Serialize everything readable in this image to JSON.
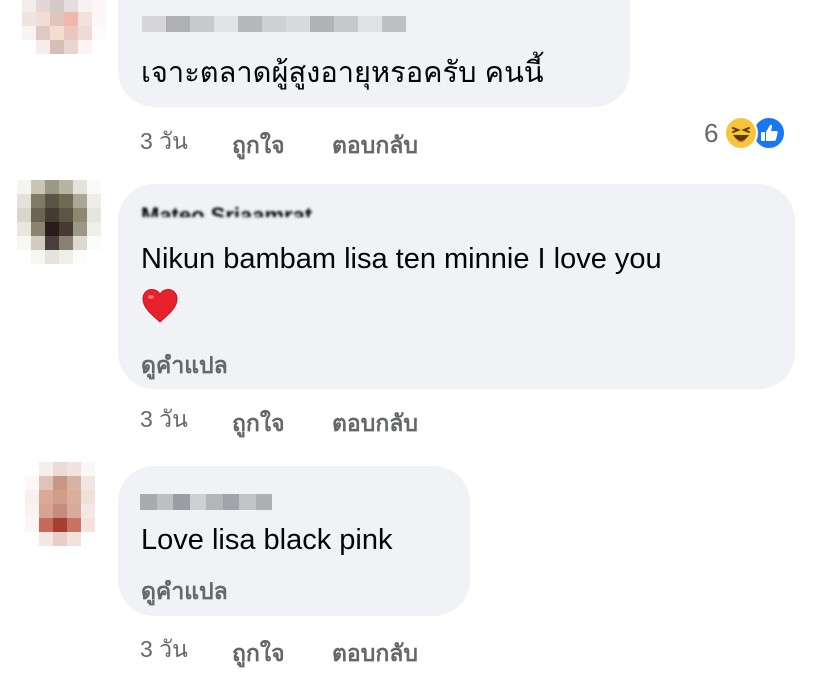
{
  "comments": [
    {
      "text": "เจาะตลาดผู้สูงอายุหรอครับ คนนี้",
      "time": "3 วัน",
      "like_label": "ถูกใจ",
      "reply_label": "ตอบกลับ",
      "reaction_count": "6",
      "reaction_icons": [
        "laughing-emoji-icon",
        "thumbs-up-icon"
      ]
    },
    {
      "author": "Mateo Sriaamrat",
      "text": "Nikun bambam lisa ten minnie I love you",
      "emoji": "❤️",
      "translate_label": "ดูคำแปล",
      "time": "3 วัน",
      "like_label": "ถูกใจ",
      "reply_label": "ตอบกลับ"
    },
    {
      "text": "Love lisa black pink",
      "translate_label": "ดูคำแปล",
      "time": "3 วัน",
      "like_label": "ถูกใจ",
      "reply_label": "ตอบกลับ"
    }
  ],
  "colors": {
    "bubble": "#f0f2f5",
    "meta_text": "#65676b",
    "like_blue": "#1877f2",
    "laugh_yellow": "#f7c53c"
  }
}
